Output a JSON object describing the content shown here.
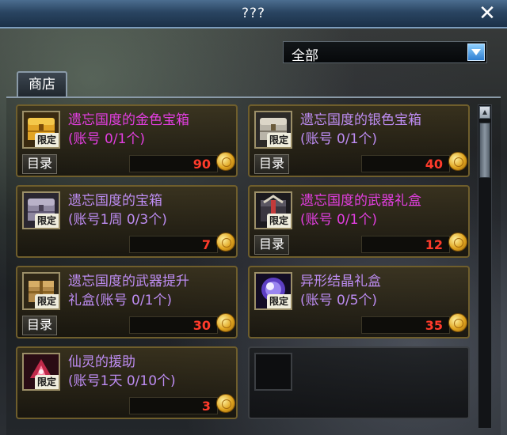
{
  "window": {
    "title": "???",
    "close_icon": "close-icon"
  },
  "filter": {
    "selected": "全部",
    "arrow_icon": "chevron-down-icon"
  },
  "tabs": [
    {
      "label": "商店"
    }
  ],
  "shop": {
    "catalog_label": "目录",
    "limited_badge": "限定",
    "currency_icon": "gold-coin-icon",
    "colors": {
      "magenta": "#e23ee0",
      "purple": "#bd8cf2",
      "price": "#ff3b2b"
    },
    "items": [
      {
        "name": "遗忘国度的金色宝箱\n(账号 0/1个)",
        "price": "90",
        "color": "magenta",
        "icon": "gold-chest-icon"
      },
      {
        "name": "遗忘国度的银色宝箱\n(账号 0/1个)",
        "price": "40",
        "color": "purple",
        "icon": "silver-chest-icon"
      },
      {
        "name": "遗忘国度的宝箱\n(账号1周 0/3个)",
        "price": "7",
        "color": "purple",
        "icon": "chest-icon"
      },
      {
        "name": "遗忘国度的武器礼盒\n(账号 0/1个)",
        "price": "12",
        "color": "magenta",
        "icon": "weapon-giftbox-icon"
      },
      {
        "name": "遗忘国度的武器提升\n礼盒(账号 0/1个)",
        "price": "30",
        "color": "purple",
        "icon": "weapon-upgrade-box-icon"
      },
      {
        "name": "异形结晶礼盒\n(账号 0/5个)",
        "price": "35",
        "color": "purple",
        "icon": "crystal-orb-icon"
      },
      {
        "name": "仙灵的援助\n(账号1天 0/10个)",
        "price": "3",
        "color": "purple",
        "icon": "fairy-aid-icon"
      }
    ]
  }
}
